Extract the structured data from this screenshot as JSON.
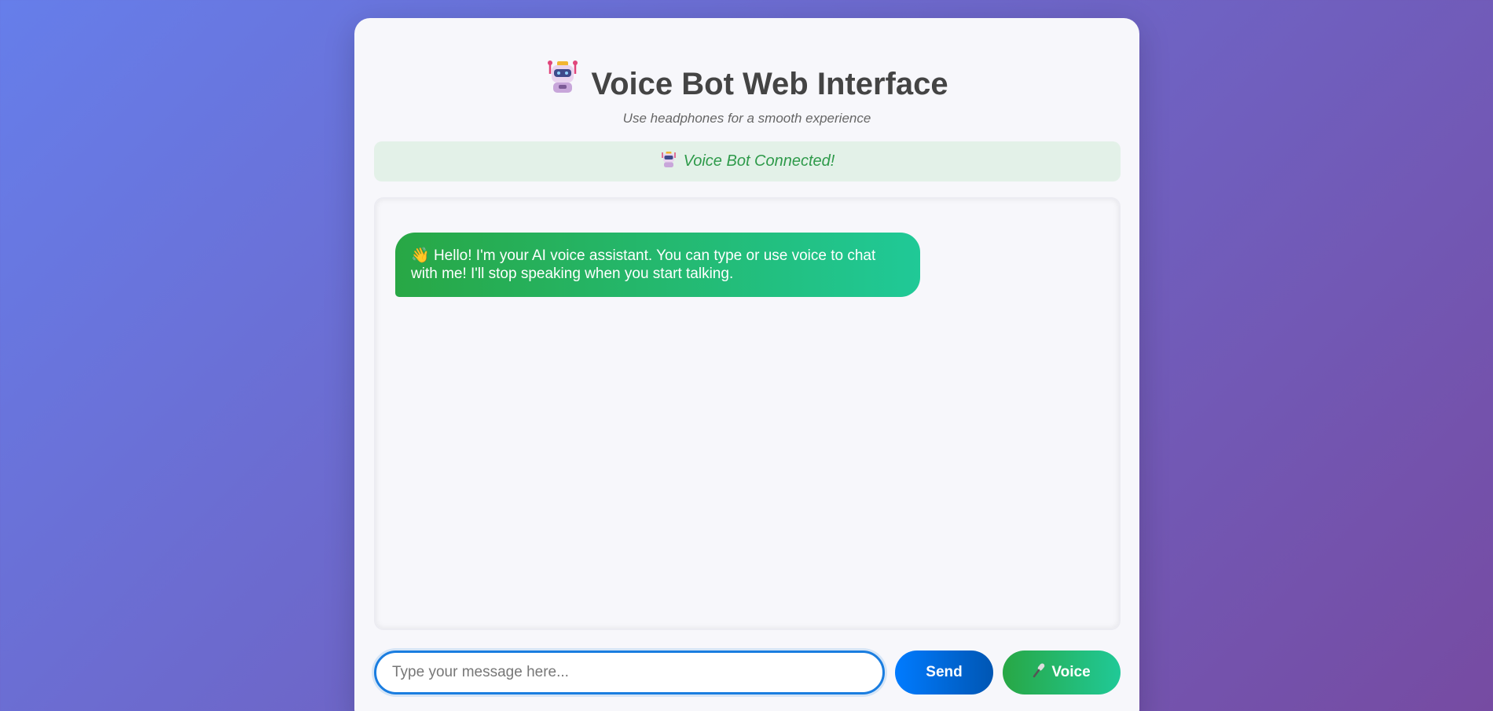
{
  "header": {
    "title": "Voice Bot Web Interface",
    "subtitle": "Use headphones for a smooth experience",
    "title_icon": "robot-icon"
  },
  "status": {
    "text": "Voice Bot Connected!",
    "icon": "robot-icon",
    "color": "#2e9a4a"
  },
  "chat": {
    "messages": [
      {
        "sender": "bot",
        "icon": "waving-hand-icon",
        "text": "Hello! I'm your AI voice assistant. You can type or use voice to chat with me! I'll stop speaking when you start talking."
      }
    ]
  },
  "composer": {
    "placeholder": "Type your message here...",
    "value": "",
    "send_label": "Send",
    "voice_label": "Voice",
    "voice_icon": "microphone-icon"
  },
  "colors": {
    "accent_blue": "#007bff",
    "accent_green": "#28a745",
    "accent_teal": "#20c997"
  }
}
